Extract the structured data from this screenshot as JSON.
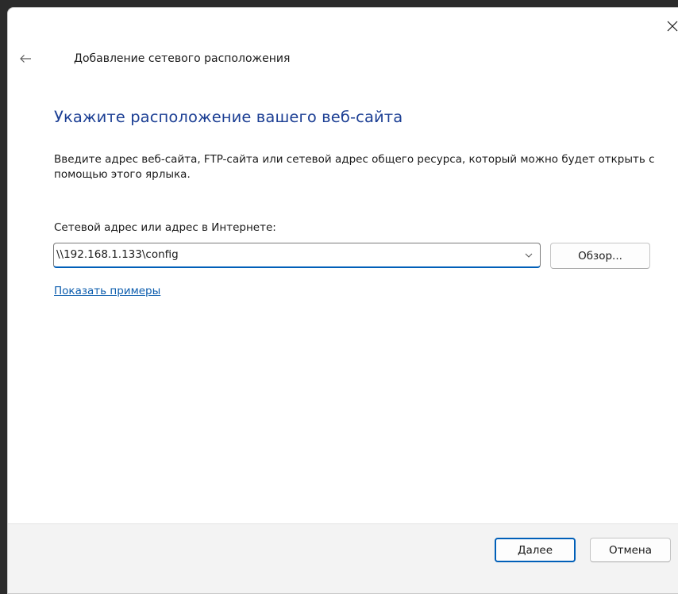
{
  "wizard": {
    "title": "Добавление сетевого расположения",
    "heading": "Укажите расположение вашего веб-сайта",
    "description": "Введите адрес веб-сайта, FTP-сайта или сетевой адрес общего ресурса, который можно будет открыть с помощью этого ярлыка.",
    "field_label": "Сетевой адрес или адрес в Интернете:",
    "address_value": "\\\\192.168.1.133\\config",
    "browse_label": "Обзор...",
    "examples_link": "Показать примеры"
  },
  "footer": {
    "next_label": "Далее",
    "cancel_label": "Отмена"
  },
  "icons": {
    "back": "arrow-left-icon",
    "close": "close-icon",
    "dropdown": "chevron-down-icon"
  },
  "colors": {
    "accent": "#005fb8",
    "heading": "#1c3f94",
    "link": "#0b5cad",
    "footer_bg": "#f3f3f3"
  }
}
